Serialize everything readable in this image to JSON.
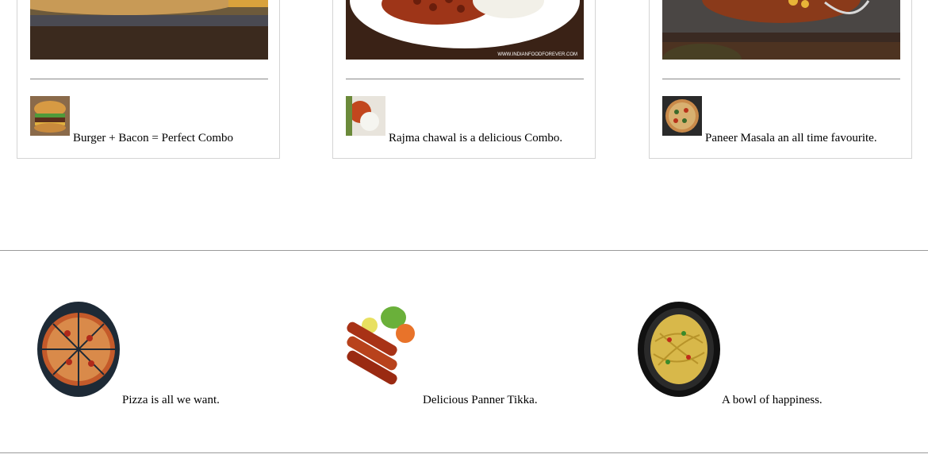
{
  "cards": [
    {
      "caption": "Burger + Bacon = Perfect Combo"
    },
    {
      "caption": "Rajma chawal is a delicious Combo.",
      "watermark": "WWW.INDIANFOODFOREVER.COM"
    },
    {
      "caption": "Paneer Masala an all time favourite."
    }
  ],
  "round_items": [
    {
      "caption": "Pizza is all we want."
    },
    {
      "caption": "Delicious Panner Tikka."
    },
    {
      "caption": "A bowl of happiness."
    }
  ]
}
